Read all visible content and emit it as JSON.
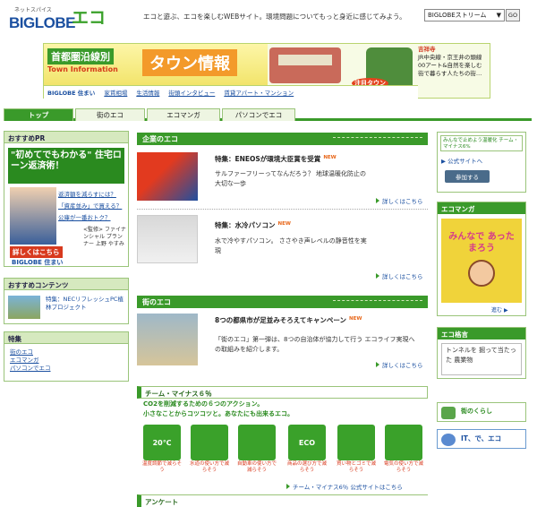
{
  "header": {
    "logo_sub": "ネットスパイス",
    "logo_main": "BIGLOBE",
    "eco_logo": "エコ",
    "tagline": "エコと遊ぶ、エコを楽しむWEBサイト。環境問題についてもっと身近に感じてみよう。",
    "search_select": "BIGLOBEストリーム",
    "go_label": "GO"
  },
  "banner": {
    "line1": "首都圏沿線別",
    "line2": "Town Information",
    "big": "タウン情報",
    "right_a": "吉祥寺",
    "right_b": "JR中央線・京王井の頭線",
    "right_c": "00アート&自然を楽しむ 街で暮らす人たちの街…",
    "badge": "注目タウン",
    "nav_brand": "BIGLOBE 住まい",
    "nav": [
      "家賃相場",
      "生活情報",
      "街頭インタビュー",
      "賃貸アパート・マンション"
    ]
  },
  "tabs": [
    "トップ",
    "街のエコ",
    "エコマンガ",
    "パソコンでエコ"
  ],
  "left": {
    "pr_head": "おすすめPR",
    "pr_title": "\"初めてでもわかる\" 住宅ローン返済術！",
    "pr_links": [
      "返済額を減らすには？",
      "「資産並み」で買える？",
      "公庫が一番おトク？"
    ],
    "pr_detail": "詳しくはこちら",
    "pr_brand": "BIGLOBE 住まい",
    "pr_caption": "<監修> ファイナンシャル プランナー 上野 やすみ",
    "contents_head": "おすすめコンテンツ",
    "contents_text": "特集：NECリフレッシュPC植林プロジェクト",
    "feature_head": "特集",
    "feature_links": [
      "街のエコ",
      "エコマンガ",
      "パソコンでエコ"
    ]
  },
  "main": {
    "kigyo_head": "企業のエコ",
    "item1_title": "特集：ENEOSが環境大臣賞を受賞",
    "item1_desc": "サルファーフリーってなんだろう？ 地球温暖化防止の大切な一歩",
    "item2_title": "特集：水冷パソコン",
    "item2_desc": "水で冷やすパソコン。 ささやき声レベルの静音性を実現",
    "machi_head": "街のエコ",
    "item3_title": "8つの都県市が足並みそろえてキャンペーン",
    "item3_desc": "「街のエコ」第一弾は、8つの自治体が協力して行う エコライフ実現への取組みを紹介します。",
    "new": "NEW",
    "more": "詳しくはこちら",
    "minus_head": "チーム・マイナス６％",
    "minus_sub1": "CO2を削減するための６つのアクション。",
    "minus_sub2": "小さなことからコツコツと。あなたにも出来るエコ。",
    "minus_items": [
      {
        "icon": "20℃",
        "cap": "温度調節で減らそう"
      },
      {
        "icon": "",
        "cap": "水道の使い方で減らそう"
      },
      {
        "icon": "",
        "cap": "自動車の使い方で減らそう"
      },
      {
        "icon": "ECO",
        "cap": "商品の選び方で減らそう"
      },
      {
        "icon": "",
        "cap": "買い物とゴミで減らそう"
      },
      {
        "icon": "",
        "cap": "電気の使い方で減らそう"
      }
    ],
    "minus_link": "チーム・マイナス6％ 公式サイトはこちら",
    "enquete": "アンケート"
  },
  "right": {
    "minna_head": "みんなで止めよう温暖化 チーム・マイナス6%",
    "minna_link": "公式サイトへ",
    "join": "参加する",
    "ecomanga_head": "エコマンガ",
    "ecomanga_art": "みんなで あったまろう",
    "ecomanga_go": "進む",
    "kakugen_head": "エコ格言",
    "kakugen_text": "トンネルを 掘って当たった 農業物",
    "kurashi": "街のくらし",
    "ittecoco": "IT、で、エコ"
  }
}
